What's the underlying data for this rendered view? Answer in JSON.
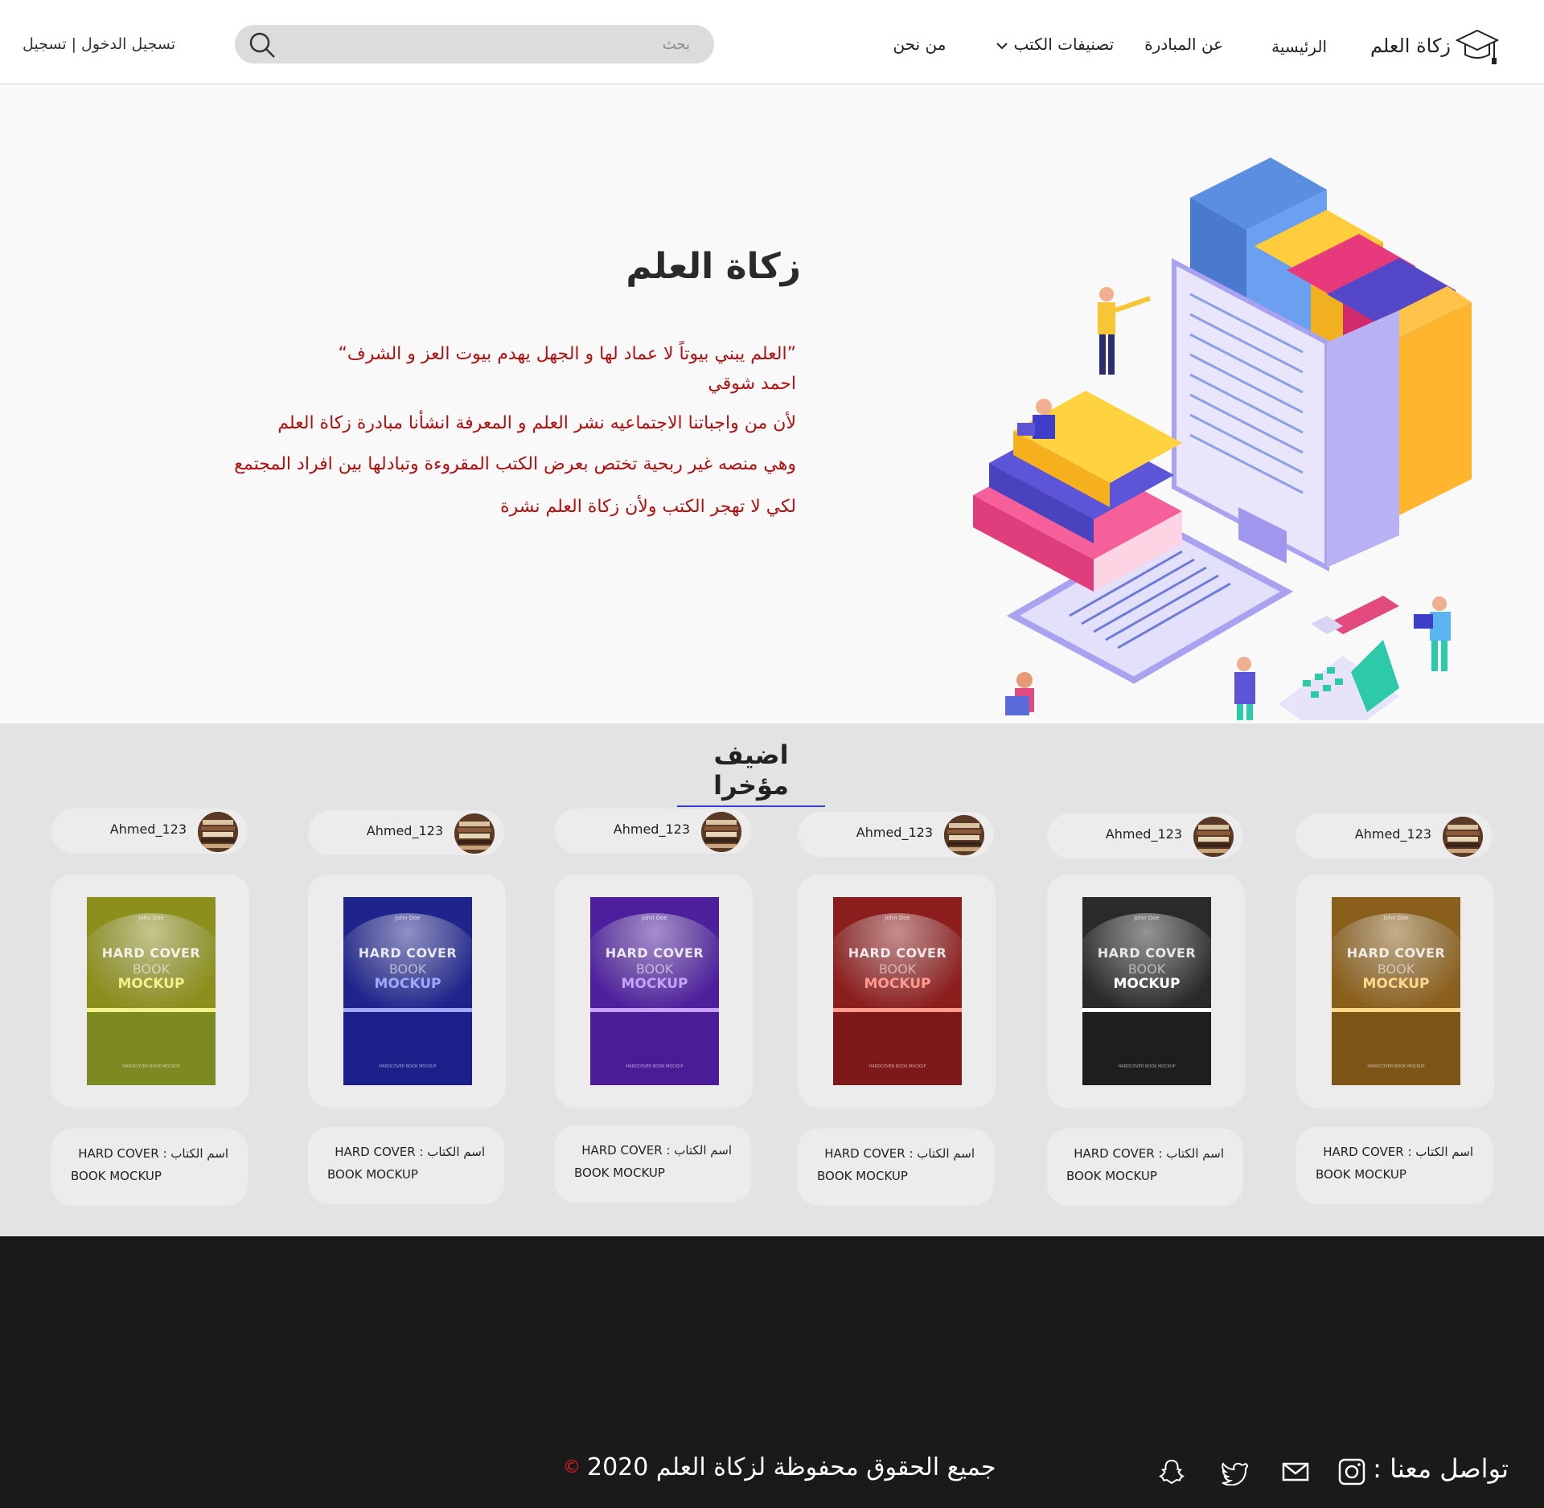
{
  "nav": {
    "logo_text": "زكاة العلم",
    "home": "الرئيسية",
    "about_initiative": "عن المبادرة",
    "categories": "تصنيفات الكتب",
    "about_us": "من نحن",
    "search_placeholder": "بحث",
    "login": "تسجيل الدخول",
    "separator": "|",
    "register": "تسجيل"
  },
  "hero": {
    "title": "زكاة العلم",
    "quote": "”العلم يبني بيوتاً لا عماد لها و الجهل يهدم بيوت العز و الشرف“",
    "author": "احمد شوقي",
    "line1": "لأن من واجباتنا الاجتماعيه نشر العلم و المعرفة انشأنا مبادرة زكاة العلم",
    "line2": "وهي منصه غير ربحية تختص بعرض الكتب المقروءة وتبادلها بين افراد المجتمع",
    "line3": "لكي لا تهجر الكتب ولأن زكاة العلم نشرة"
  },
  "recent": {
    "title": "اضيف مؤخرا",
    "books": [
      {
        "user": "Ahmed_123",
        "name_label": "اسم الكتاب",
        "name_line1": "HARD COVER",
        "name_line2": "BOOK MOCKUP",
        "author": "John Doe",
        "cover_t1": "HARD COVER",
        "cover_t2": "BOOK",
        "cover_t3": "MOCKUP",
        "cover_foot": "HARDCOVER BOOK MOCKUP",
        "color_top": "#8c8f1c",
        "color_bottom": "#7d8a22",
        "accent": "#f4f08a"
      },
      {
        "user": "Ahmed_123",
        "name_label": "اسم الكتاب",
        "name_line1": "HARD COVER",
        "name_line2": "BOOK MOCKUP",
        "author": "John Doe",
        "cover_t1": "HARD COVER",
        "cover_t2": "BOOK",
        "cover_t3": "MOCKUP",
        "cover_foot": "HARDCOVER BOOK MOCKUP",
        "color_top": "#1f238c",
        "color_bottom": "#1a1f8a",
        "accent": "#9ea8ff"
      },
      {
        "user": "Ahmed_123",
        "name_label": "اسم الكتاب",
        "name_line1": "HARD COVER",
        "name_line2": "BOOK MOCKUP",
        "author": "John Doe",
        "cover_t1": "HARD COVER",
        "cover_t2": "BOOK",
        "cover_t3": "MOCKUP",
        "cover_foot": "HARDCOVER BOOK MOCKUP",
        "color_top": "#4d1f9c",
        "color_bottom": "#4a1c95",
        "accent": "#c8a0ff"
      },
      {
        "user": "Ahmed_123",
        "name_label": "اسم الكتاب",
        "name_line1": "HARD COVER",
        "name_line2": "BOOK MOCKUP",
        "author": "John Doe",
        "cover_t1": "HARD COVER",
        "cover_t2": "BOOK",
        "cover_t3": "MOCKUP",
        "cover_foot": "HARDCOVER BOOK MOCKUP",
        "color_top": "#8c1d1d",
        "color_bottom": "#7f1818",
        "accent": "#ff9a90"
      },
      {
        "user": "Ahmed_123",
        "name_label": "اسم الكتاب",
        "name_line1": "HARD COVER",
        "name_line2": "BOOK MOCKUP",
        "author": "John Doe",
        "cover_t1": "HARD COVER",
        "cover_t2": "BOOK",
        "cover_t3": "MOCKUP",
        "cover_foot": "HARDCOVER BOOK MOCKUP",
        "color_top": "#2a2a2a",
        "color_bottom": "#1e1e1e",
        "accent": "#ffffff"
      },
      {
        "user": "Ahmed_123",
        "name_label": "اسم الكتاب",
        "name_line1": "HARD COVER",
        "name_line2": "BOOK MOCKUP",
        "author": "John Doe",
        "cover_t1": "HARD COVER",
        "cover_t2": "BOOK",
        "cover_t3": "MOCKUP",
        "cover_foot": "HARDCOVER BOOK MOCKUP",
        "color_top": "#8a5f1c",
        "color_bottom": "#7d5516",
        "accent": "#ffd88a"
      }
    ]
  },
  "footer": {
    "copyright": "جميع الحقوق محفوظة لزكاة العلم 2020",
    "copyright_mark": "©",
    "contact_label": "تواصل معنا :",
    "social_icons": [
      "instagram-icon",
      "mail-icon",
      "twitter-icon",
      "snapchat-icon"
    ]
  },
  "colors": {
    "hero_text": "#b01010",
    "title_underline": "#3c3ccc",
    "footer_bg": "#1a1a1a",
    "section_bg": "#e3e3e3"
  }
}
